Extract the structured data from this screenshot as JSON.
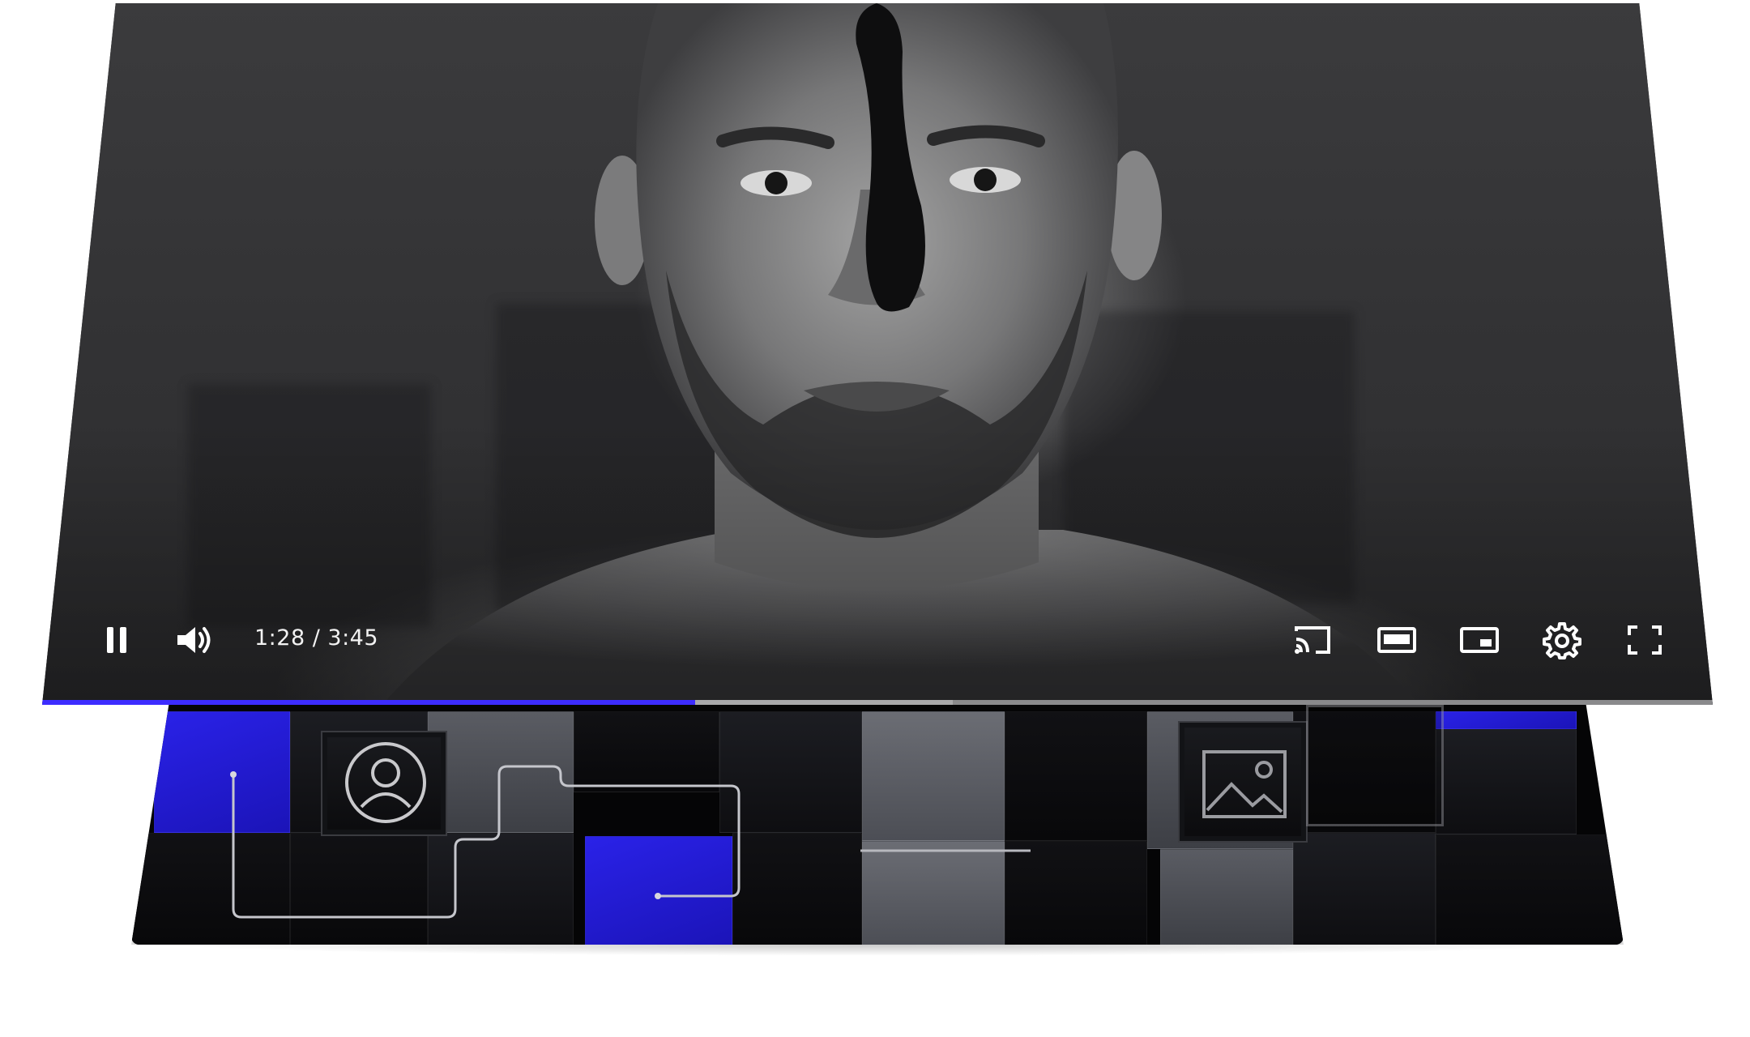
{
  "player": {
    "current_time": "1:28",
    "separator": " / ",
    "duration": "3:45",
    "progress_fraction": 0.3911,
    "buffered_fraction": 0.545,
    "state": "playing",
    "accent_color": "#3d2cff"
  },
  "controls": {
    "left": [
      {
        "name": "pause",
        "icon": "pause-icon"
      },
      {
        "name": "volume",
        "icon": "volume-icon"
      }
    ],
    "right": [
      {
        "name": "cast",
        "icon": "cast-icon"
      },
      {
        "name": "theater-mode",
        "icon": "theater-mode-icon"
      },
      {
        "name": "miniplayer",
        "icon": "miniplayer-icon"
      },
      {
        "name": "settings",
        "icon": "gear-icon"
      },
      {
        "name": "fullscreen",
        "icon": "fullscreen-icon"
      }
    ]
  },
  "board": {
    "tile_icons": [
      "person-icon",
      "image-icon"
    ],
    "colors": {
      "blue": "#2a22e8",
      "gray": "#5a5c63",
      "dark": "#08080a"
    }
  }
}
